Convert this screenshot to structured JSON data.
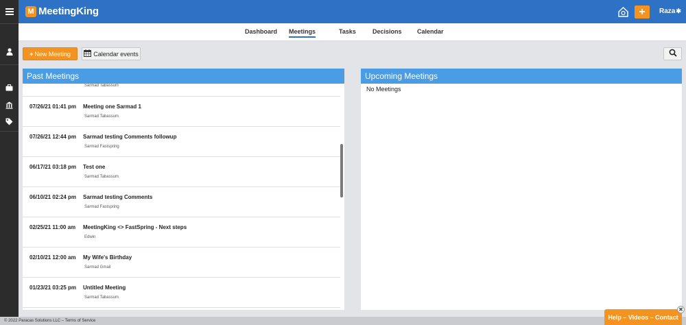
{
  "app": {
    "logo_mark": "M",
    "logo_text": "MeetingKing",
    "user_name": "Raza"
  },
  "colors": {
    "brand_blue": "#2d72c4",
    "accent_orange": "#f39422",
    "panel_header": "#4a9de5",
    "rail": "#2c2c2c"
  },
  "icons": [
    "menu-icon",
    "user-icon",
    "briefcase-icon",
    "bank-icon",
    "tag-icon",
    "notification-icon",
    "plus-icon",
    "gear-icon",
    "calendar-icon",
    "search-icon",
    "close-icon"
  ],
  "nav": {
    "tabs": [
      {
        "label": "Dashboard"
      },
      {
        "label": "Meetings",
        "active": true
      },
      {
        "label": "Tasks"
      },
      {
        "label": "Decisions"
      },
      {
        "label": "Calendar"
      }
    ]
  },
  "toolbar": {
    "new_meeting_icon": "+",
    "new_meeting_label": "New Meeting",
    "calendar_events_label": "Calendar events"
  },
  "past_meetings": {
    "title": "Past Meetings",
    "partial_top_owner": "Sarmad Tabassum",
    "rows": [
      {
        "date": "07/26/21 01:41 pm",
        "title": "Meeting one Sarmad 1",
        "owner": "Sarmad Tabassum"
      },
      {
        "date": "07/26/21 12:44 pm",
        "title": "Sarmad testing Comments followup",
        "owner": "Sarmad Fastspring"
      },
      {
        "date": "06/17/21 03:18 pm",
        "title": "Test one",
        "owner": "Sarmad Tabassum"
      },
      {
        "date": "06/10/21 02:24 pm",
        "title": "Sarmad testing Comments",
        "owner": "Sarmad Fastspring"
      },
      {
        "date": "02/25/21 11:00 am",
        "title": "MeetingKing <> FastSpring - Next steps",
        "owner": "Edwin"
      },
      {
        "date": "02/10/21 12:00 am",
        "title": "My Wife's Birthday",
        "owner": "Sarmad Gmail"
      },
      {
        "date": "01/23/21 03:25 pm",
        "title": "Untitled Meeting",
        "owner": "Sarmad Tabassum"
      }
    ]
  },
  "upcoming_meetings": {
    "title": "Upcoming Meetings",
    "empty_text": "No Meetings"
  },
  "footer": {
    "text": "© 2022 Paracas Solutions LLC – Terms of Service"
  },
  "help": {
    "label": "Help – Videos – Contact",
    "close": "✖"
  }
}
